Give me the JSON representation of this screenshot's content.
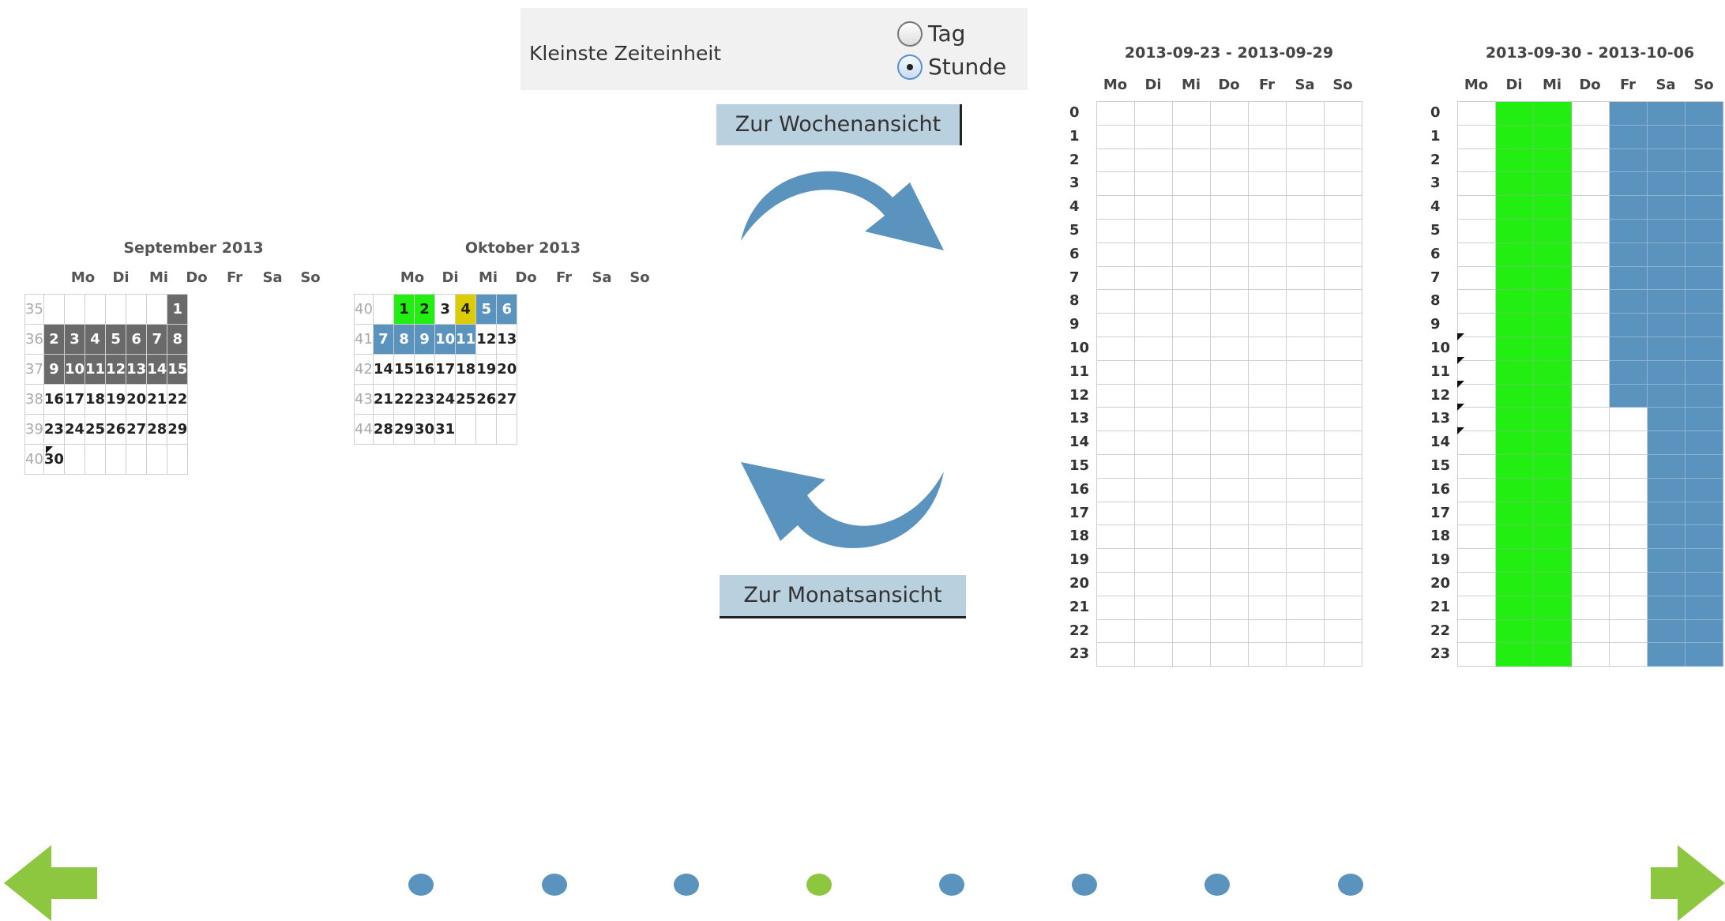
{
  "settings": {
    "label": "Kleinste Zeiteinheit",
    "options": [
      "Tag",
      "Stunde"
    ],
    "selected": "Stunde"
  },
  "buttons": {
    "week_view": "Zur Wochenansicht",
    "month_view": "Zur Monatsansicht"
  },
  "weekdays": [
    "Mo",
    "Di",
    "Mi",
    "Do",
    "Fr",
    "Sa",
    "So"
  ],
  "month_calendars": [
    {
      "title": "September 2013",
      "rows": [
        {
          "week": "35",
          "days": [
            "",
            "",
            "",
            "",
            "",
            "",
            "1"
          ]
        },
        {
          "week": "36",
          "days": [
            "2",
            "3",
            "4",
            "5",
            "6",
            "7",
            "8"
          ]
        },
        {
          "week": "37",
          "days": [
            "9",
            "10",
            "11",
            "12",
            "13",
            "14",
            "15"
          ]
        },
        {
          "week": "38",
          "days": [
            "16",
            "17",
            "18",
            "19",
            "20",
            "21",
            "22"
          ]
        },
        {
          "week": "39",
          "days": [
            "23",
            "24",
            "25",
            "26",
            "27",
            "28",
            "29"
          ]
        },
        {
          "week": "40",
          "days": [
            "30",
            "",
            "",
            "",
            "",
            "",
            ""
          ]
        }
      ]
    },
    {
      "title": "Oktober 2013",
      "rows": [
        {
          "week": "40",
          "days": [
            "",
            "1",
            "2",
            "3",
            "4",
            "5",
            "6"
          ]
        },
        {
          "week": "41",
          "days": [
            "7",
            "8",
            "9",
            "10",
            "11",
            "12",
            "13"
          ]
        },
        {
          "week": "42",
          "days": [
            "14",
            "15",
            "16",
            "17",
            "18",
            "19",
            "20"
          ]
        },
        {
          "week": "43",
          "days": [
            "21",
            "22",
            "23",
            "24",
            "25",
            "26",
            "27"
          ]
        },
        {
          "week": "44",
          "days": [
            "28",
            "29",
            "30",
            "31",
            "",
            "",
            ""
          ]
        }
      ]
    }
  ],
  "week_grids": [
    {
      "title": "2013-09-23 - 2013-09-29"
    },
    {
      "title": "2013-09-30 - 2013-10-06"
    }
  ],
  "hours": [
    "0",
    "1",
    "2",
    "3",
    "4",
    "5",
    "6",
    "7",
    "8",
    "9",
    "10",
    "11",
    "12",
    "13",
    "14",
    "15",
    "16",
    "17",
    "18",
    "19",
    "20",
    "21",
    "22",
    "23"
  ],
  "colors": {
    "green": "#22ee11",
    "blue": "#5b93bf",
    "yellow": "#dccc00",
    "dark_gray": "#6a6a6a",
    "nav_green": "#8dc63f",
    "nav_blue": "#5b93bf",
    "button_bg": "#b9d1df"
  },
  "icons": {
    "prev": "arrow-left-icon",
    "next": "arrow-right-icon",
    "cycle_top": "curved-arrow-right-icon",
    "cycle_bottom": "curved-arrow-left-icon"
  },
  "nav": {
    "dot_count": 8,
    "active_dot": 4
  }
}
